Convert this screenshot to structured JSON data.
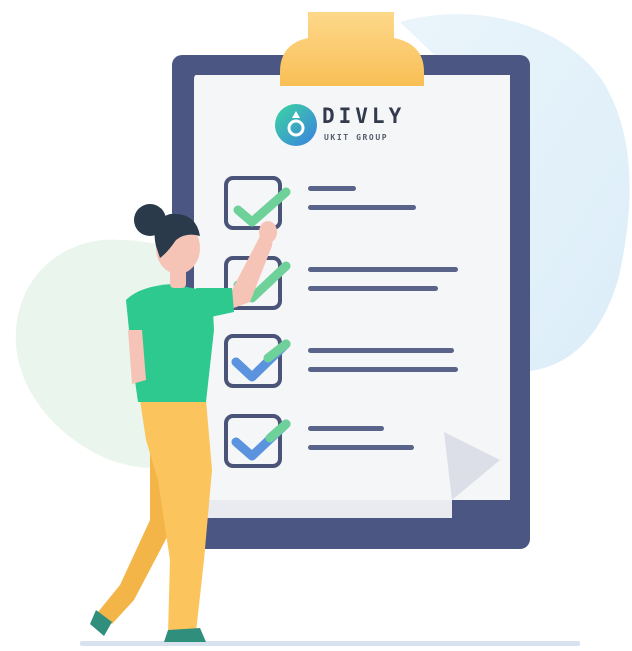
{
  "logo": {
    "name": "DIVLY",
    "tagline": "UKIT GROUP"
  },
  "checklist": {
    "items": [
      {
        "checked": true
      },
      {
        "checked": true
      },
      {
        "checked": true
      },
      {
        "checked": true
      }
    ]
  },
  "colors": {
    "blob": "#e3f0f9",
    "board_frame": "#4c5683",
    "paper": "#f5f6f8",
    "clip": "#fccb6b",
    "check_green": "#6fd19a",
    "check_blue": "#5b93df",
    "box_stroke": "#4a5478",
    "line_color": "#5a6389",
    "shirt": "#2ec98f",
    "pants": "#fcc45c",
    "hair": "#2a3a4a",
    "skin": "#f6c4b6"
  }
}
